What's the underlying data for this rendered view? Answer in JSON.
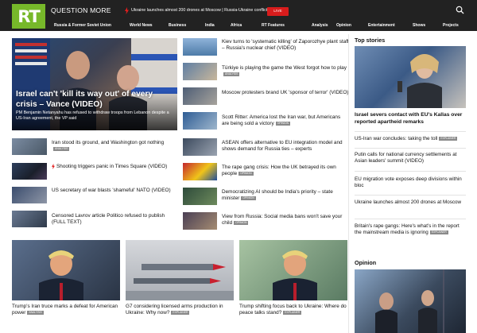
{
  "header": {
    "logo": "RT",
    "tagline": "QUESTION MORE",
    "ticker": "Ukraine launches almost 200 drones at Moscow | Russia-Ukraine conflict",
    "live": "LIVE",
    "icons": [
      "bolt-icon",
      "search-icon"
    ]
  },
  "nav": {
    "items": [
      "Russia & Former Soviet Union",
      "World News",
      "Business",
      "India",
      "Africa",
      "RT Features",
      "Analysis",
      "Opinion",
      "Entertainment",
      "Shows",
      "Projects"
    ]
  },
  "hero": {
    "title": "Israel can't 'kill its way out' of every crisis – Vance (VIDEO)",
    "summary": "PM Benjamin Netanyahu has refused to withdraw troops from Lebanon despite a US-Iran agreement, the VP said"
  },
  "left_list": [
    {
      "title": "Iran stood its ground, and Washington got nothing",
      "badge": "ANALYSIS"
    },
    {
      "title": "Shooting triggers panic in Times Square (VIDEO)",
      "badge": ""
    },
    {
      "title": "US secretary of war blasts 'shameful' NATO (VIDEO)",
      "badge": ""
    },
    {
      "title": "Censored Lavrov article Politico refused to publish (FULL TEXT)",
      "badge": ""
    }
  ],
  "mid_list": [
    {
      "title": "Kiev turns to 'systematic killing' of Zaporozhye plant staff – Russia's nuclear chief (VIDEO)",
      "badge": ""
    },
    {
      "title": "Türkiye is playing the game the West forgot how to play",
      "badge": "ANALYSIS"
    },
    {
      "title": "Moscow protesters brand UK 'sponsor of terror' (VIDEO)",
      "badge": ""
    },
    {
      "title": "Scott Ritter: America lost the Iran war, but Americans are being sold a victory",
      "badge": "OPINION"
    },
    {
      "title": "ASEAN offers alternative to EU integration model and shows demand for Russia ties – experts",
      "badge": ""
    },
    {
      "title": "The rape gang crisis: How the UK betrayed its own people",
      "badge": "OPINION"
    },
    {
      "title": "Democratizing AI should be India's priority – state minister",
      "badge": "OPINION"
    },
    {
      "title": "View from Russia: Social media bans won't save your child",
      "badge": "OPINION"
    }
  ],
  "top_stories": {
    "heading": "Top stories",
    "lead": "Israel severs contact with EU's Kallas over reported apartheid remarks",
    "items": [
      {
        "title": "US-Iran war concludes: taking the toll",
        "badge": "EXPLAINER"
      },
      {
        "title": "Putin calls for national currency settlements at Asian leaders' summit (VIDEO)",
        "badge": ""
      },
      {
        "title": "EU migration vote exposes deep divisions within bloc",
        "badge": ""
      },
      {
        "title": "Ukraine launches almost 200 drones at Moscow",
        "badge": ""
      },
      {
        "title": "Britain's rape gangs: Here's what's in the report the mainstream media is ignoring",
        "badge": "EXPLAINER"
      }
    ]
  },
  "opinion": {
    "heading": "Opinion"
  },
  "bottom": [
    {
      "title": "Trump's Iran truce marks a defeat for American power",
      "badge": "ANALYSIS"
    },
    {
      "title": "G7 considering licensed arms production in Ukraine: Why now?",
      "badge": "EXPLAINER"
    },
    {
      "title": "Trump shifting focus back to Ukraine: Where do peace talks stand?",
      "badge": "EXPLAINER"
    }
  ],
  "colors": {
    "brand": "#77b82a",
    "dark": "#222222",
    "live": "#d81c1c",
    "badge": "#8a8a8a"
  }
}
